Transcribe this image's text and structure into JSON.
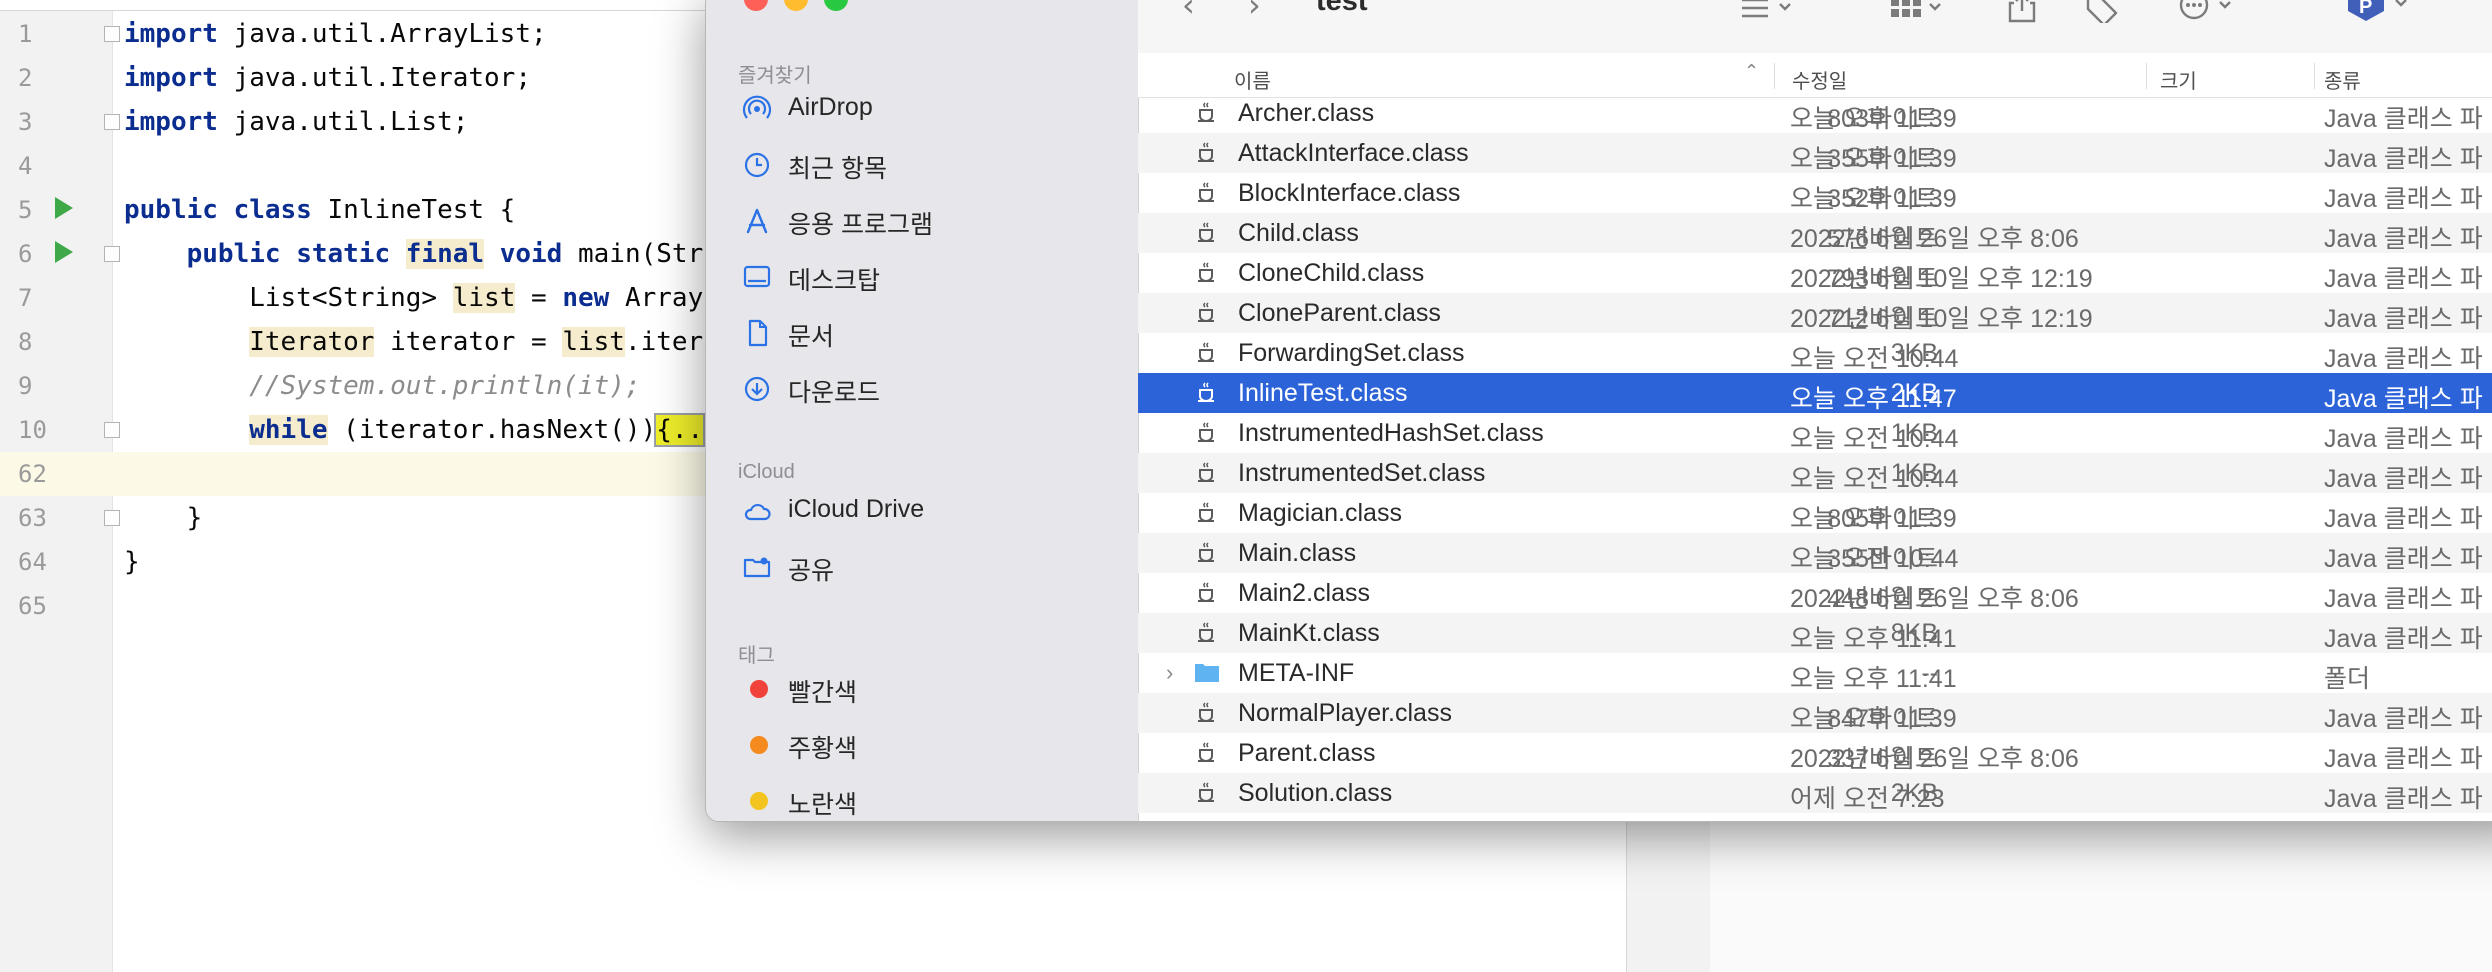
{
  "ide": {
    "lines": [
      {
        "no": "1",
        "code": "import java.util.ArrayList;"
      },
      {
        "no": "2",
        "code": "import java.util.Iterator;"
      },
      {
        "no": "3",
        "code": "import java.util.List;"
      },
      {
        "no": "4",
        "code": ""
      },
      {
        "no": "5",
        "code": "public class InlineTest {"
      },
      {
        "no": "6",
        "code": "    public static final void main(Stri"
      },
      {
        "no": "7",
        "code": "        List<String> list = new ArrayL"
      },
      {
        "no": "8",
        "code": "        Iterator iterator = list.itera"
      },
      {
        "no": "9",
        "code": "        //System.out.println(it);"
      },
      {
        "no": "10",
        "code": "        while (iterator.hasNext()){.."
      },
      {
        "no": "62",
        "code": ""
      },
      {
        "no": "63",
        "code": "    }"
      },
      {
        "no": "64",
        "code": "}"
      },
      {
        "no": "65",
        "code": ""
      }
    ],
    "folded_placeholder": "{.."
  },
  "finder": {
    "title": "test",
    "sidebar": {
      "favorites_header": "즐겨찾기",
      "favorites": [
        {
          "label": "AirDrop",
          "icon": "airdrop-icon"
        },
        {
          "label": "최근 항목",
          "icon": "clock-icon"
        },
        {
          "label": "응용 프로그램",
          "icon": "applications-icon"
        },
        {
          "label": "데스크탑",
          "icon": "desktop-icon"
        },
        {
          "label": "문서",
          "icon": "document-icon"
        },
        {
          "label": "다운로드",
          "icon": "download-icon"
        }
      ],
      "icloud_header": "iCloud",
      "icloud": [
        {
          "label": "iCloud Drive",
          "icon": "cloud-icon"
        },
        {
          "label": "공유",
          "icon": "shared-folder-icon"
        }
      ],
      "tags_header": "태그",
      "tags": [
        {
          "label": "빨간색",
          "color": "#f0413a"
        },
        {
          "label": "주황색",
          "color": "#f58a1f"
        },
        {
          "label": "노란색",
          "color": "#f3c420"
        }
      ]
    },
    "columns": {
      "name": "이름",
      "date": "수정일",
      "size": "크기",
      "kind": "종류"
    },
    "files": [
      {
        "name": "Archer.class",
        "date": "오늘 오후 11:39",
        "size": "803바이트",
        "kind": "Java 클래스 파"
      },
      {
        "name": "AttackInterface.class",
        "date": "오늘 오후 11:39",
        "size": "355바이트",
        "kind": "Java 클래스 파"
      },
      {
        "name": "BlockInterface.class",
        "date": "오늘 오후 11:39",
        "size": "352바이트",
        "kind": "Java 클래스 파"
      },
      {
        "name": "Child.class",
        "date": "2022년 6월 26일 오후 8:06",
        "size": "576바이트",
        "kind": "Java 클래스 파"
      },
      {
        "name": "CloneChild.class",
        "date": "2022년 6월 10일 오후 12:19",
        "size": "793바이트",
        "kind": "Java 클래스 파"
      },
      {
        "name": "CloneParent.class",
        "date": "2022년 6월 10일 오후 12:19",
        "size": "712바이트",
        "kind": "Java 클래스 파"
      },
      {
        "name": "ForwardingSet.class",
        "date": "오늘 오전 10:44",
        "size": "3KB",
        "kind": "Java 클래스 파"
      },
      {
        "name": "InlineTest.class",
        "date": "오늘 오후 11:47",
        "size": "2KB",
        "kind": "Java 클래스 파",
        "selected": true
      },
      {
        "name": "InstrumentedHashSet.class",
        "date": "오늘 오전 10:44",
        "size": "1KB",
        "kind": "Java 클래스 파"
      },
      {
        "name": "InstrumentedSet.class",
        "date": "오늘 오전 10:44",
        "size": "1KB",
        "kind": "Java 클래스 파"
      },
      {
        "name": "Magician.class",
        "date": "오늘 오후 11:39",
        "size": "805바이트",
        "kind": "Java 클래스 파"
      },
      {
        "name": "Main.class",
        "date": "오늘 오전 10:44",
        "size": "355바이트",
        "kind": "Java 클래스 파"
      },
      {
        "name": "Main2.class",
        "date": "2022년 6월 26일 오후 8:06",
        "size": "448바이트",
        "kind": "Java 클래스 파"
      },
      {
        "name": "MainKt.class",
        "date": "오늘 오후 11:41",
        "size": "8KB",
        "kind": "Java 클래스 파"
      },
      {
        "name": "META-INF",
        "date": "오늘 오후 11:41",
        "size": "--",
        "kind": "폴더",
        "folder": true
      },
      {
        "name": "NormalPlayer.class",
        "date": "오늘 오후 11:39",
        "size": "847바이트",
        "kind": "Java 클래스 파"
      },
      {
        "name": "Parent.class",
        "date": "2022년 6월 26일 오후 8:06",
        "size": "337바이트",
        "kind": "Java 클래스 파"
      },
      {
        "name": "Solution.class",
        "date": "어제 오전 7:23",
        "size": "2KB",
        "kind": "Java 클래스 파"
      }
    ]
  }
}
